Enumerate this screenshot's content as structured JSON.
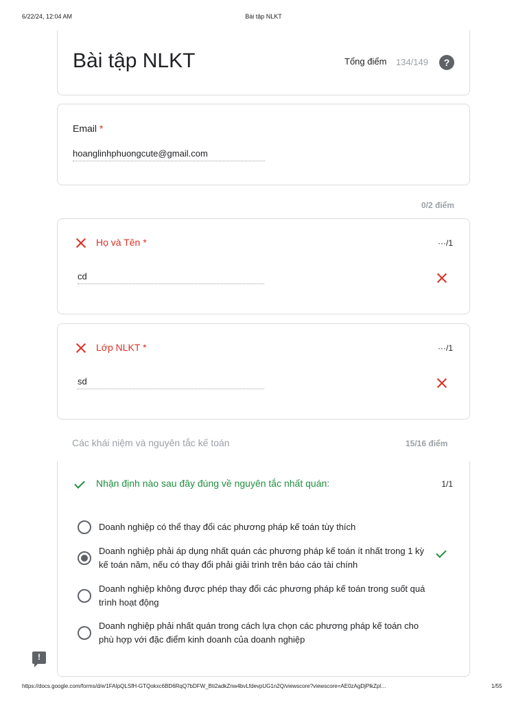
{
  "print_header": {
    "date": "6/22/24, 12:04 AM",
    "title": "Bài tập NLKT"
  },
  "form": {
    "title": "Bài tập NLKT",
    "total_label": "Tổng điểm",
    "total_value": "134/149",
    "help_glyph": "?"
  },
  "email": {
    "label": "Email",
    "required": "*",
    "value": "hoanglinhphuongcute@gmail.com"
  },
  "section1": {
    "score": "0/2 điểm"
  },
  "questions_wrong": [
    {
      "title": "Họ và Tên *",
      "points": "···/1",
      "answer": "cd"
    },
    {
      "title": "Lớp NLKT *",
      "points": "···/1",
      "answer": "sd"
    }
  ],
  "section2": {
    "title": "Các khái niệm và nguyên tắc kế toán",
    "score": "15/16 điểm"
  },
  "mcq": {
    "question": "Nhận định nào sau đây đúng về nguyên tắc nhất quán:",
    "points": "1/1",
    "options": [
      {
        "text": "Doanh nghiệp có thể thay đổi các phương pháp kế toán tùy thích"
      },
      {
        "text": "Doanh nghiệp phải áp dụng nhất quán các phương pháp kế toán ít nhất trong 1 kỳ kế toán năm, nếu có thay đổi phải giải trình trên báo cáo tài chính"
      },
      {
        "text": "Doanh nghiệp không được phép thay đổi các phương pháp kế toán trong suốt quá trình hoạt động"
      },
      {
        "text": "Doanh nghiệp phải nhất quán trong cách lựa chọn các phương pháp kế toán cho phù hợp với đặc điểm kinh doanh của doanh nghiệp"
      }
    ],
    "selected_index": 1
  },
  "feedback": {
    "glyph": "!"
  },
  "print_footer": {
    "url": "https://docs.google.com/forms/d/e/1FAIpQLSfH-GTQokxc6BD6RqQ7bDFW_Bti2adkZnw4bvLfdevpUG1n2Q/viewscore?viewscore=AE0zAgDjPlkZpl…",
    "page": "1/55"
  },
  "colors": {
    "error": "#d93025",
    "success": "#1e8e3e",
    "muted": "#9aa0a6",
    "border": "#dadce0"
  },
  "icons": {
    "wrong": "close-x-icon",
    "correct": "checkmark-icon",
    "help": "question-circle-icon",
    "feedback": "feedback-icon"
  }
}
